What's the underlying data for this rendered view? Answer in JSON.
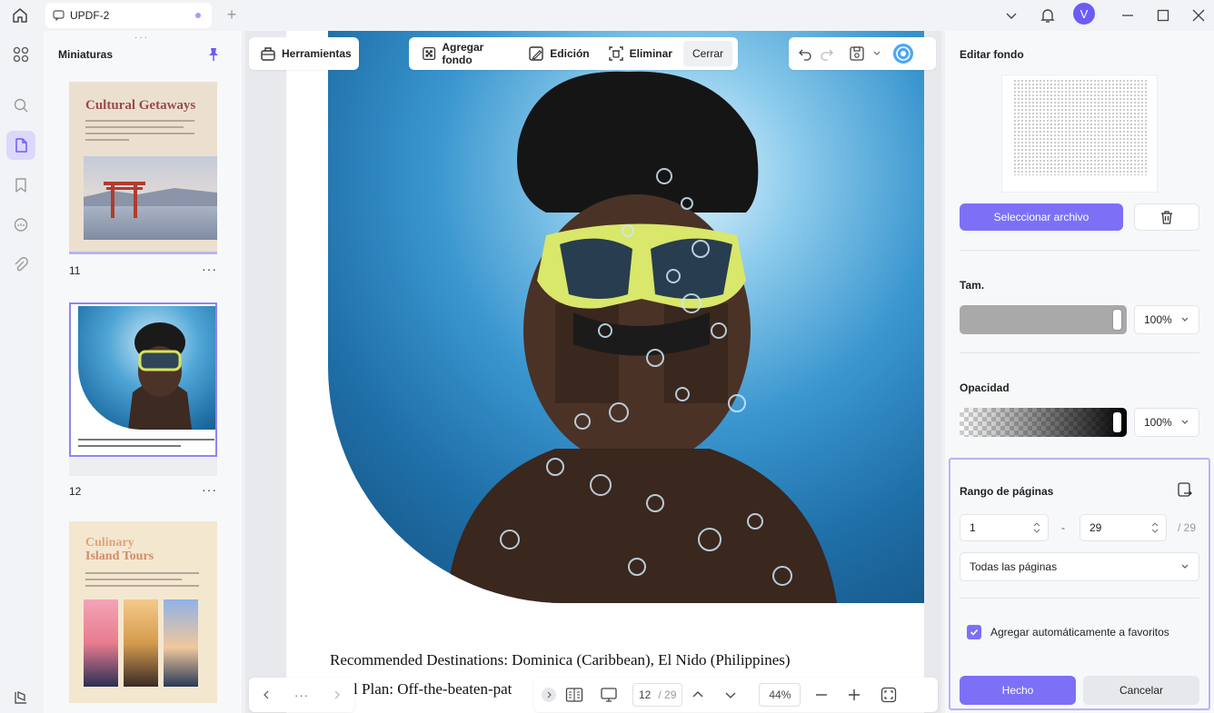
{
  "tab": {
    "title": "UPDF-2"
  },
  "user": {
    "initial": "V"
  },
  "thumbnails": {
    "title": "Miniaturas",
    "pages": [
      {
        "number": "11",
        "heading": "Cultural Getaways"
      },
      {
        "number": "12"
      },
      {
        "heading_line1": "Culinary",
        "heading_line2": "Island Tours"
      }
    ],
    "more": "···"
  },
  "toolbar": {
    "tools": "Herramientas",
    "add_background": "Agregar fondo",
    "edit": "Edición",
    "delete": "Eliminar",
    "close": "Cerrar"
  },
  "document": {
    "line1": "Recommended Destinations: Dominica (Caribbean), El Nido (Philippines)",
    "line2": "vel Plan: Off-the-beaten-pat"
  },
  "nav": {
    "more": "···",
    "current_page": "12",
    "total_pages": "/ 29",
    "zoom": "44%"
  },
  "panel": {
    "title": "Editar fondo",
    "select_file": "Seleccionar archivo",
    "size_label": "Tam.",
    "size_value": "100%",
    "opacity_label": "Opacidad",
    "opacity_value": "100%",
    "range_label": "Rango de páginas",
    "range_from": "1",
    "range_sep": "-",
    "range_to": "29",
    "range_total": "/ 29",
    "range_mode": "Todas las páginas",
    "favorites_label": "Agregar automáticamente a favoritos",
    "done": "Hecho",
    "cancel": "Cancelar"
  },
  "colors": {
    "accent": "#7d70f7",
    "highlight_border": "#b9b3f6"
  }
}
